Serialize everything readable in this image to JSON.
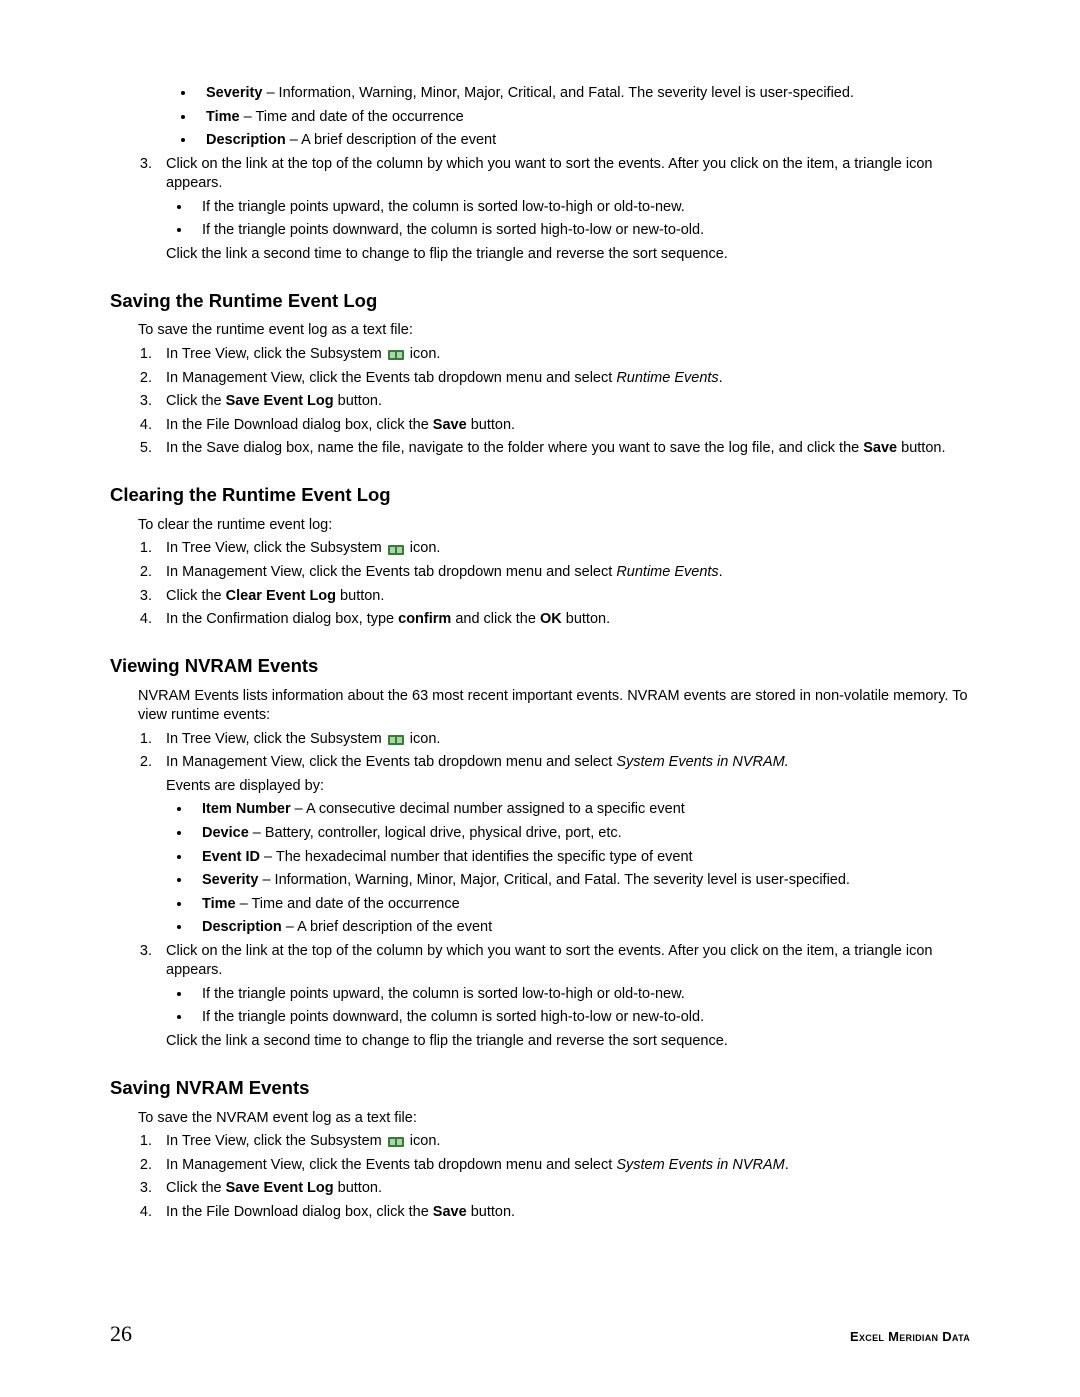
{
  "topList": {
    "severity": {
      "label": "Severity",
      "text": " – Information, Warning, Minor, Major, Critical, and Fatal. The severity level is user-specified."
    },
    "time": {
      "label": "Time",
      "text": " – Time and date of the occurrence"
    },
    "description": {
      "label": "Description",
      "text": " – A brief description of the event"
    }
  },
  "topStep3": {
    "text": "Click on the link at the top of the column by which you want to sort the events. After you click on the item, a triangle icon appears.",
    "bullets": [
      "If the triangle points upward, the column is sorted low-to-high or old-to-new.",
      "If the triangle points downward, the column is sorted high-to-low or new-to-old."
    ],
    "after": "Click the link a second time to change to flip the triangle and reverse the sort sequence."
  },
  "savingRuntime": {
    "heading": "Saving the Runtime Event Log",
    "intro": "To save the runtime event log as a text file:",
    "steps": {
      "s1a": "In Tree View, click the Subsystem ",
      "s1b": " icon.",
      "s2a": "In Management View, click the Events tab dropdown menu and select ",
      "s2i": "Runtime Events",
      "s2b": ".",
      "s3a": "Click the ",
      "s3b": "Save Event Log",
      "s3c": " button.",
      "s4a": "In the File Download dialog box, click the ",
      "s4b": "Save",
      "s4c": " button.",
      "s5a": "In the Save dialog box, name the file, navigate to the folder where you want to save the log file, and click the ",
      "s5b": "Save",
      "s5c": " button."
    }
  },
  "clearingRuntime": {
    "heading": "Clearing the Runtime Event Log",
    "intro": "To clear the runtime event log:",
    "steps": {
      "s1a": "In Tree View, click the Subsystem ",
      "s1b": " icon.",
      "s2a": "In Management View, click the Events tab dropdown menu and select ",
      "s2i": "Runtime Events",
      "s2b": ".",
      "s3a": "Click the ",
      "s3b": "Clear Event Log",
      "s3c": " button.",
      "s4a": "In the Confirmation dialog box, type ",
      "s4b": "confirm",
      "s4c": " and click the ",
      "s4d": "OK",
      "s4e": " button."
    }
  },
  "viewingNvram": {
    "heading": "Viewing NVRAM Events",
    "intro": "NVRAM Events lists information about the 63 most recent important events. NVRAM events are stored in non-volatile memory. To view runtime events:",
    "steps": {
      "s1a": "In Tree View, click the Subsystem ",
      "s1b": " icon.",
      "s2a": "In Management View, click the Events tab dropdown menu and select ",
      "s2i": "System Events in NVRAM.",
      "s2after": "Events are displayed by:",
      "fields": {
        "itemNumber": {
          "label": "Item Number",
          "text": " – A consecutive decimal number assigned to a specific event"
        },
        "device": {
          "label": "Device",
          "text": " – Battery, controller, logical drive, physical drive, port, etc."
        },
        "eventId": {
          "label": "Event ID",
          "text": " – The hexadecimal number that identifies the specific type of event"
        },
        "severity": {
          "label": "Severity",
          "text": " – Information, Warning, Minor, Major, Critical, and Fatal. The severity level is user-specified."
        },
        "time": {
          "label": "Time",
          "text": " – Time and date of the occurrence"
        },
        "description": {
          "label": "Description",
          "text": " – A brief description of the event"
        }
      },
      "s3text": "Click on the link at the top of the column by which you want to sort the events. After you click on the item, a triangle icon appears.",
      "s3bullets": [
        "If the triangle points upward, the column is sorted low-to-high or old-to-new.",
        "If the triangle points downward, the column is sorted high-to-low or new-to-old."
      ],
      "s3after": "Click the link a second time to change to flip the triangle and reverse the sort sequence."
    }
  },
  "savingNvram": {
    "heading": "Saving NVRAM Events",
    "intro": "To save the NVRAM event log as a text file:",
    "steps": {
      "s1a": "In Tree View, click the Subsystem ",
      "s1b": " icon.",
      "s2a": "In Management View, click the Events tab dropdown menu and select ",
      "s2i": "System Events in NVRAM",
      "s2b": ".",
      "s3a": "Click the ",
      "s3b": "Save Event Log",
      "s3c": " button.",
      "s4a": "In the File Download dialog box, click the ",
      "s4b": "Save",
      "s4c": " button."
    }
  },
  "footer": {
    "page": "26",
    "brand": "Excel Meridian Data"
  }
}
